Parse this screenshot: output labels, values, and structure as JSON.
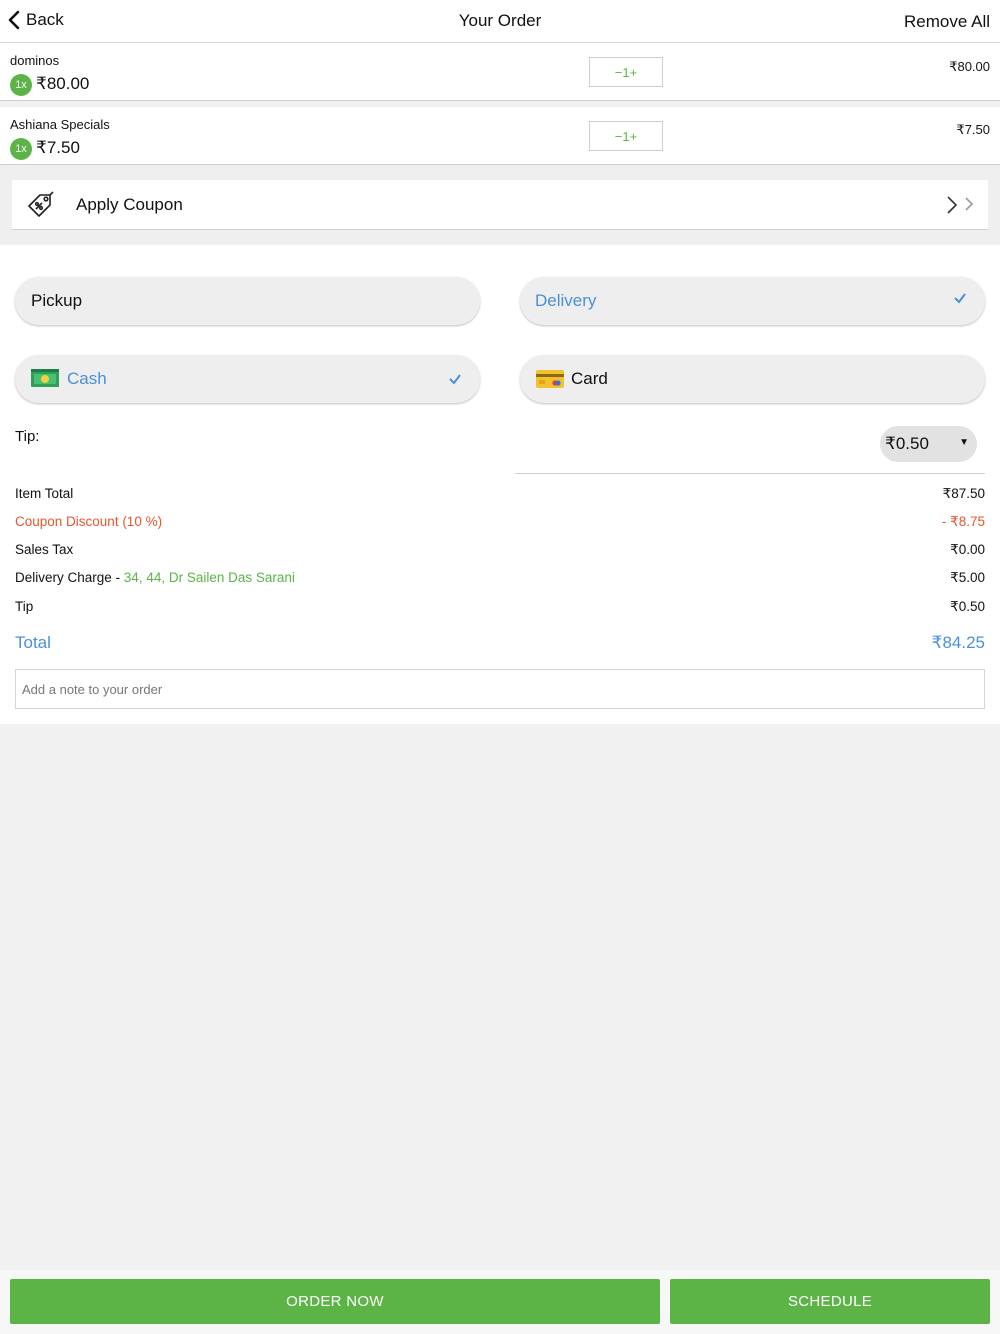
{
  "header": {
    "back_label": "Back",
    "title": "Your Order",
    "remove_all_label": "Remove All"
  },
  "items": [
    {
      "name": "dominos",
      "qty": "1x",
      "unit_price": "₹80.00",
      "stepper": "−1+",
      "line_total": "₹80.00"
    },
    {
      "name": "Ashiana Specials",
      "qty": "1x",
      "unit_price": "₹7.50",
      "stepper": "−1+",
      "line_total": "₹7.50"
    }
  ],
  "coupon": {
    "label": "Apply Coupon"
  },
  "order_type": {
    "pickup_label": "Pickup",
    "delivery_label": "Delivery",
    "selected": "delivery"
  },
  "payment": {
    "cash_label": "Cash",
    "card_label": "Card",
    "selected": "cash"
  },
  "tip": {
    "label": "Tip:",
    "selected_value": "₹0.50"
  },
  "summary": {
    "item_total_label": "Item Total",
    "item_total_value": "₹87.50",
    "discount_label": "Coupon Discount (10 %)",
    "discount_value": "- ₹8.75",
    "sales_tax_label": "Sales Tax",
    "sales_tax_value": "₹0.00",
    "delivery_label": "Delivery Charge - ",
    "delivery_address": "34, 44, Dr Sailen Das Sarani",
    "delivery_value": "₹5.00",
    "tip_label": "Tip",
    "tip_value": "₹0.50",
    "total_label": "Total",
    "total_value": "₹84.25"
  },
  "note": {
    "placeholder": "Add a note to your order"
  },
  "actions": {
    "order_now_label": "ORDER NOW",
    "schedule_label": "SCHEDULE"
  },
  "colors": {
    "accent_green": "#5cb346",
    "selected_blue": "#4a90d9",
    "discount_orange": "#e8552b"
  }
}
